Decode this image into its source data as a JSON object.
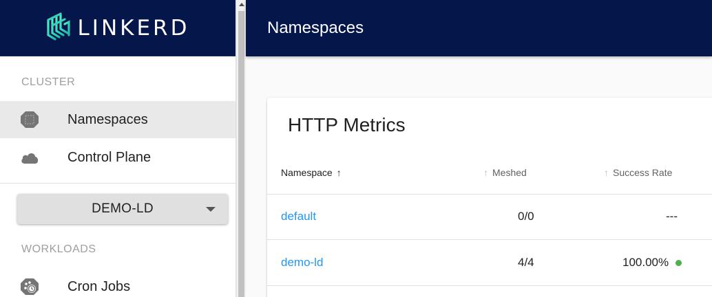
{
  "brand": {
    "name": "LINKERD"
  },
  "sidebar": {
    "cluster_title": "CLUSTER",
    "items": [
      {
        "label": "Namespaces",
        "icon": "namespace-icon",
        "active": true
      },
      {
        "label": "Control Plane",
        "icon": "cloud-icon",
        "active": false
      }
    ],
    "namespace_select": {
      "value": "DEMO-LD"
    },
    "workloads_title": "WORKLOADS",
    "workload_items": [
      {
        "label": "Cron Jobs",
        "icon": "cron-jobs-icon"
      }
    ]
  },
  "appbar": {
    "title": "Namespaces"
  },
  "metrics": {
    "title": "HTTP Metrics",
    "columns": [
      {
        "label": "Namespace",
        "sort": "asc-active"
      },
      {
        "label": "Meshed",
        "sort": "inactive"
      },
      {
        "label": "Success Rate",
        "sort": "inactive"
      }
    ],
    "rows": [
      {
        "namespace": "default",
        "meshed": "0/0",
        "success_rate": "---",
        "status": "none"
      },
      {
        "namespace": "demo-ld",
        "meshed": "4/4",
        "success_rate": "100.00%",
        "status": "good"
      }
    ]
  },
  "colors": {
    "navy": "#04164a",
    "link": "#2196f3",
    "success": "#4caf50",
    "logo_accent": "#3ee0b0"
  }
}
